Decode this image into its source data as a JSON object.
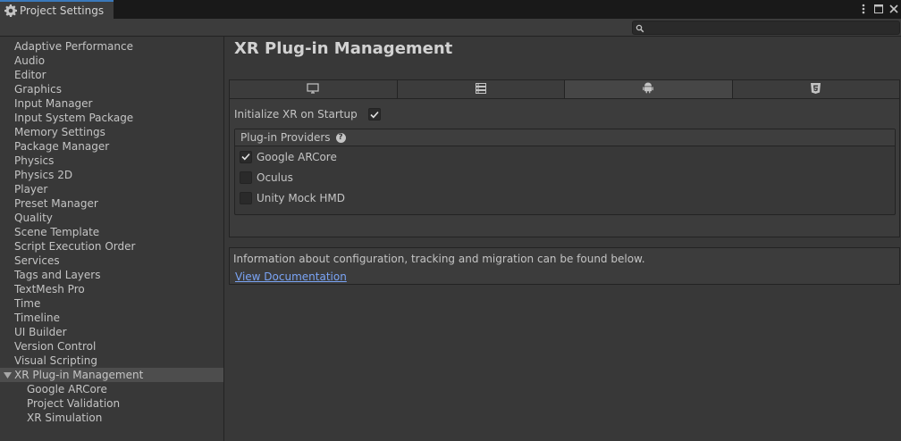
{
  "window": {
    "tab_title": "Project Settings",
    "tab_icon": "gear-icon",
    "controls": [
      "kebab-menu-icon",
      "maximize-icon",
      "close-icon"
    ]
  },
  "search": {
    "placeholder": "",
    "value": ""
  },
  "sidebar": {
    "items": [
      {
        "label": "Adaptive Performance"
      },
      {
        "label": "Audio"
      },
      {
        "label": "Editor"
      },
      {
        "label": "Graphics"
      },
      {
        "label": "Input Manager"
      },
      {
        "label": "Input System Package"
      },
      {
        "label": "Memory Settings"
      },
      {
        "label": "Package Manager"
      },
      {
        "label": "Physics"
      },
      {
        "label": "Physics 2D"
      },
      {
        "label": "Player"
      },
      {
        "label": "Preset Manager"
      },
      {
        "label": "Quality"
      },
      {
        "label": "Scene Template"
      },
      {
        "label": "Script Execution Order"
      },
      {
        "label": "Services"
      },
      {
        "label": "Tags and Layers"
      },
      {
        "label": "TextMesh Pro"
      },
      {
        "label": "Time"
      },
      {
        "label": "Timeline"
      },
      {
        "label": "UI Builder"
      },
      {
        "label": "Version Control"
      },
      {
        "label": "Visual Scripting"
      },
      {
        "label": "XR Plug-in Management"
      }
    ],
    "children": [
      {
        "label": "Google ARCore"
      },
      {
        "label": "Project Validation"
      },
      {
        "label": "XR Simulation"
      }
    ]
  },
  "main": {
    "title": "XR Plug-in Management",
    "platform_tabs": [
      {
        "icon": "desktop-icon",
        "active": false
      },
      {
        "icon": "server-icon",
        "active": false
      },
      {
        "icon": "android-icon",
        "active": true
      },
      {
        "icon": "html5-icon",
        "active": false
      }
    ],
    "init_label": "Initialize XR on Startup",
    "init_checked": true,
    "providers_header": "Plug-in Providers",
    "providers": [
      {
        "label": "Google ARCore",
        "checked": true
      },
      {
        "label": "Oculus",
        "checked": false
      },
      {
        "label": "Unity Mock HMD",
        "checked": false
      }
    ],
    "info_text": "Information about configuration, tracking and migration can be found below.",
    "doc_link": "View Documentation"
  },
  "colors": {
    "background": "#383838",
    "accent": "#3a79bb",
    "link": "#7aa4f5"
  }
}
